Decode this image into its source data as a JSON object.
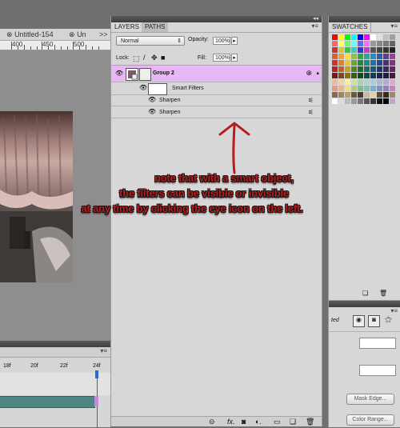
{
  "doc_tabs": [
    {
      "label": "Untitled-154"
    },
    {
      "label": "Un"
    }
  ],
  "doc_tab_overflow": ">>",
  "ruler_marks": [
    "400",
    "450",
    "500"
  ],
  "layers_panel": {
    "tabs": [
      "LAYERS",
      "PATHS"
    ],
    "blend_mode": "Normal",
    "opacity_label": "Opacity:",
    "opacity_value": "100%",
    "lock_label": "Lock:",
    "fill_label": "Fill:",
    "fill_value": "100%",
    "layers": [
      {
        "name": "Group 2"
      },
      {
        "name": "Smart Filters"
      },
      {
        "name": "Sharpen"
      },
      {
        "name": "Sharpen"
      }
    ]
  },
  "swatches_panel": {
    "tab": "SWATCHES"
  },
  "props_panel": {
    "partial_label": "ted",
    "mask_edge_button": "Mask Edge...",
    "color_range_button": "Color Range..."
  },
  "timeline": {
    "frames": [
      "18f",
      "20f",
      "22f",
      "24f"
    ]
  },
  "annotation": {
    "line1": "note that with a smart object,",
    "line2": "the filters can be visible or invisible",
    "line3": "at any time by clicking the eye icon on the left."
  },
  "colors": {
    "annotation_red": "#b71d1d",
    "selected_layer": "#e7b8f4",
    "track_teal": "#4e8683"
  },
  "icons": [
    "close-tab-icon",
    "eye-icon",
    "lock-transparency-icon",
    "lock-paint-icon",
    "lock-move-icon",
    "lock-all-icon",
    "smart-object-icon",
    "filter-options-icon",
    "link-icon",
    "fx-icon",
    "mask-icon",
    "adjustment-icon",
    "folder-icon",
    "new-layer-icon",
    "trash-icon"
  ]
}
